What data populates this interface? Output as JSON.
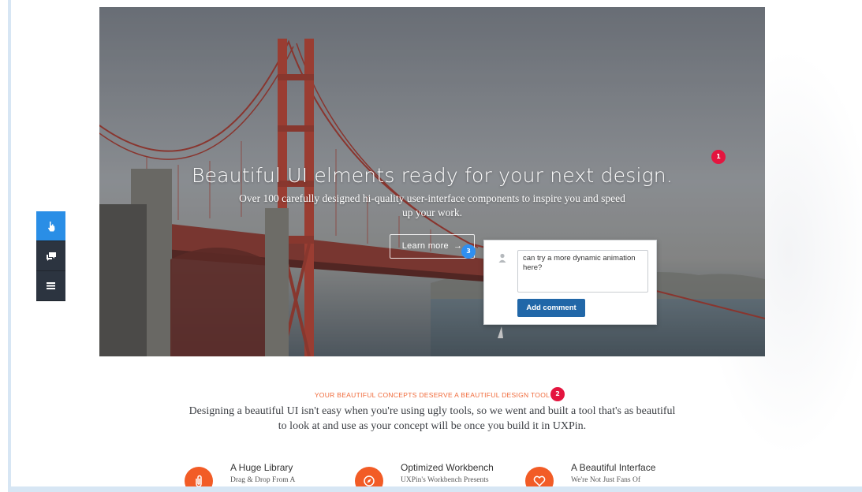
{
  "hero": {
    "title": "Beautiful UI elments ready for your next design.",
    "subtitle": "Over 100 carefully designed hi-quality user-interface components to inspire you and speed up your work.",
    "cta_label": "Learn more",
    "cta_arrow": "→"
  },
  "markers": [
    "1",
    "2",
    "3"
  ],
  "comment": {
    "text": "can try a more dynamic animation here?",
    "button_label": "Add comment"
  },
  "toolbar": {
    "items": [
      "hand-pointer-icon",
      "comments-icon",
      "list-icon"
    ],
    "active_index": 0
  },
  "section": {
    "label": "YOUR BEAUTIFUL CONCEPTS DESERVE A BEAUTIFUL DESIGN TOOL",
    "description": "Designing a beautiful UI isn't easy when you're using ugly tools, so we went and built a tool that's as beautiful to look at and use as your concept will be once you build it in UXPin."
  },
  "features": [
    {
      "title": "A Huge Library",
      "desc": "Drag & Drop From A",
      "icon": "paperclip-icon"
    },
    {
      "title": "Optimized Workbench",
      "desc": "UXPin's Workbench Presents",
      "icon": "compass-icon"
    },
    {
      "title": "A Beautiful Interface",
      "desc": "We're Not Just Fans Of",
      "icon": "heart-icon"
    }
  ],
  "colors": {
    "accent_orange": "#f25c26",
    "marker_red": "#e4153f",
    "marker_blue": "#2f8ff0",
    "button_blue": "#2167a8",
    "toolbar_dark": "#2c3440",
    "toolbar_active": "#2a8ee6"
  }
}
